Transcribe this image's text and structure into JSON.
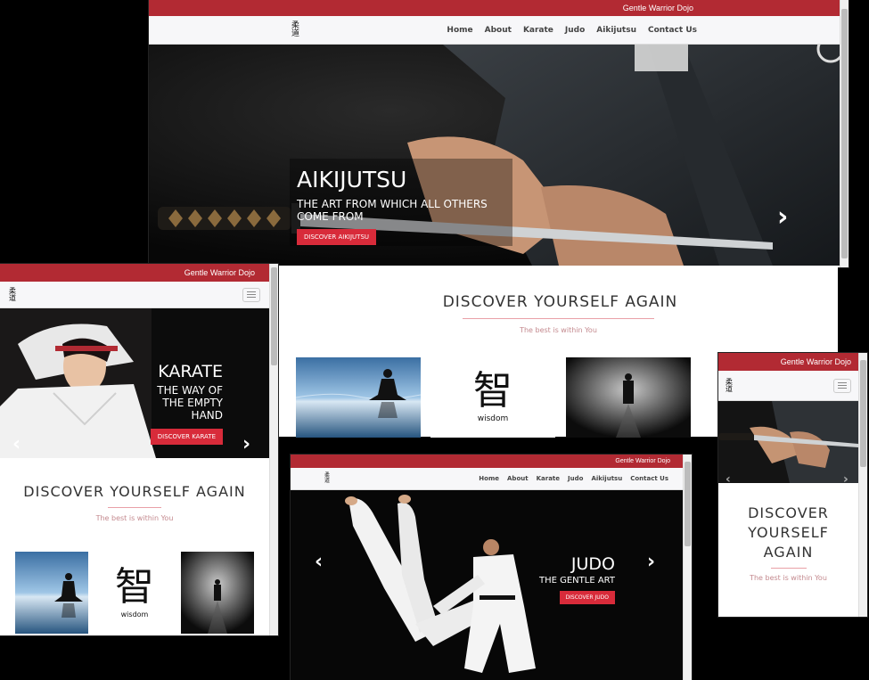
{
  "brand": "Gentle Warrior Dojo",
  "logo": {
    "kanji_top": "柔",
    "kanji_bottom": "道"
  },
  "nav": [
    "Home",
    "About",
    "Karate",
    "Judo",
    "Aikijutsu",
    "Contact Us"
  ],
  "slides": {
    "aikijutsu": {
      "title": "AIKIJUTSU",
      "subtitle_line1": "THE ART FROM WHICH ALL OTHERS",
      "subtitle_line2": "COME FROM",
      "cta": "DISCOVER AIKIJUTSU"
    },
    "karate": {
      "title": "KARATE",
      "subtitle_line1": "THE WAY OF",
      "subtitle_line2": "THE EMPTY",
      "subtitle_line3": "HAND",
      "cta": "DISCOVER KARATE"
    },
    "judo": {
      "title": "JUDO",
      "subtitle": "THE GENTLE ART",
      "cta": "DISCOVER JUDO"
    }
  },
  "section": {
    "title": "DISCOVER YOURSELF AGAIN",
    "title_line1": "DISCOVER",
    "title_line2": "YOURSELF",
    "title_line3": "AGAIN",
    "subtitle": "The best is within You"
  },
  "wisdom": {
    "kanji": "智",
    "word": "wisdom"
  },
  "arrows": {
    "prev": "‹",
    "next": "›"
  },
  "colors": {
    "brand_red": "#b22a33",
    "cta_red": "#d82b3a",
    "accent_pink": "#e9a0a7"
  }
}
